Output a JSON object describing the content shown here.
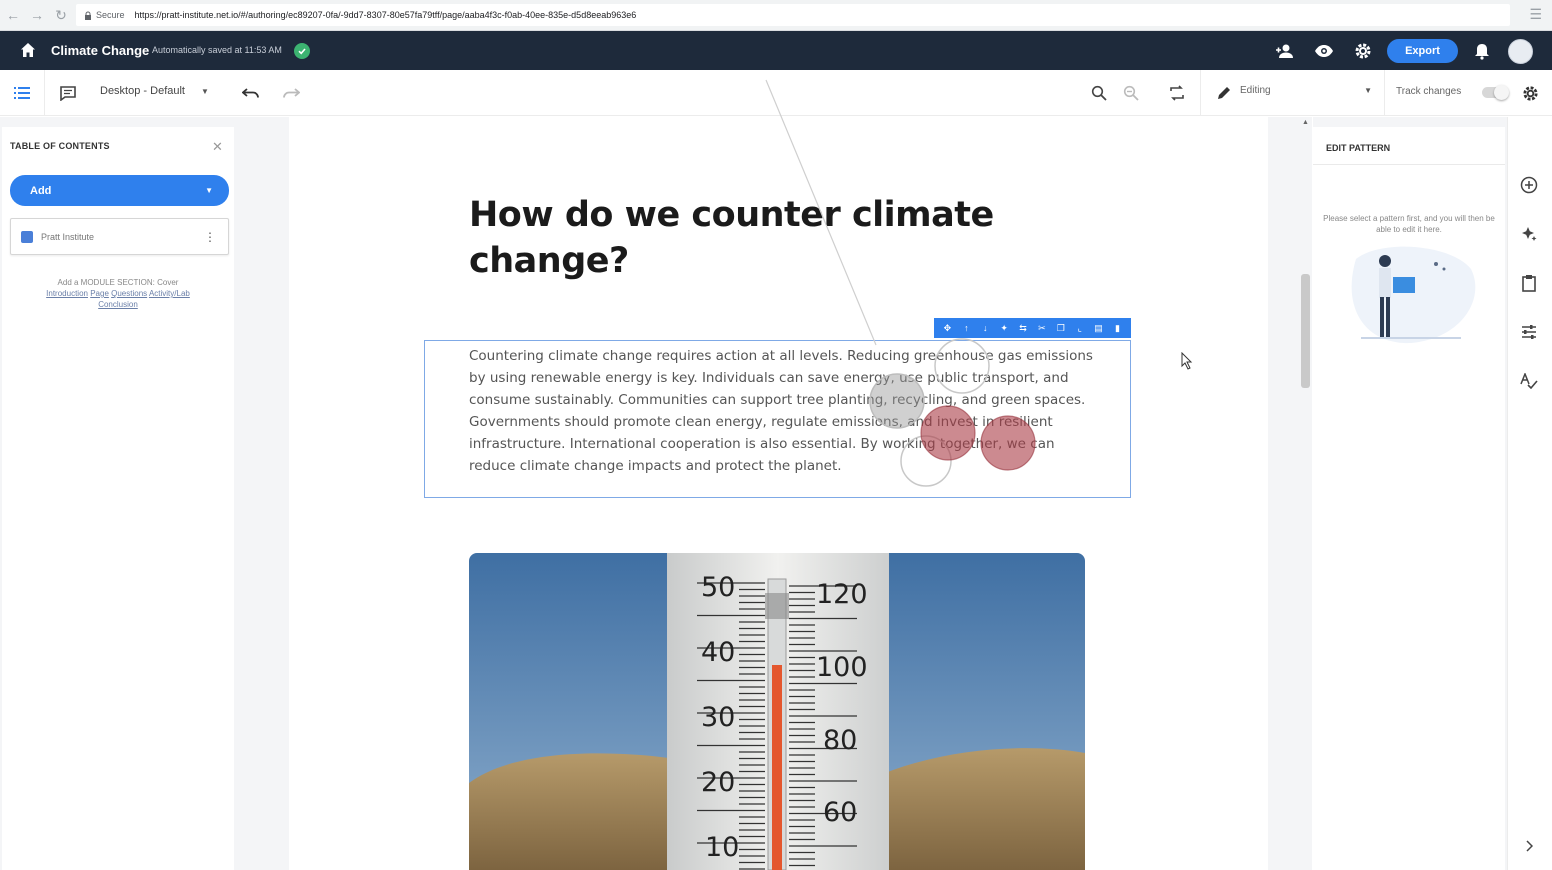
{
  "browser": {
    "secure_label": "Secure",
    "url": "https://pratt-institute.net.io/#/authoring/ec89207-0fa/-9dd7-8307-80e57fa79tff/page/aaba4f3c-f0ab-40ee-835e-d5d8eeab963e6"
  },
  "header": {
    "title": "Climate Change",
    "save_status": "Automatically saved at 11:53 AM",
    "export_label": "Export"
  },
  "toolbar": {
    "device_label": "Desktop - Default",
    "mode_label": "Editing",
    "track_changes_label": "Track changes",
    "track_changes_on": false
  },
  "toc": {
    "title": "TABLE OF CONTENTS",
    "add_label": "Add",
    "items": [
      {
        "label": "Pratt Institute"
      }
    ],
    "hint_prefix": "Add a MODULE SECTION: Cover",
    "hint_links": [
      "Introduction",
      "Page",
      "Questions",
      "Activity/Lab",
      "Conclusion"
    ]
  },
  "content": {
    "heading": "How do we counter climate change?",
    "paragraph": "Countering climate change requires action at all levels. Reducing greenhouse gas emissions by using renewable energy is key. Individuals can save energy, use public transport, and consume sustainably. Communities can support tree planting, recycling, and green spaces. Governments should promote clean energy, regulate emissions, and invest in resilient infrastructure. International cooperation is also essential. By working together, we can reduce climate change impacts and protect the planet.",
    "thermometer": {
      "left_scale": [
        "50",
        "40",
        "30",
        "20",
        "10"
      ],
      "right_scale": [
        "120",
        "100",
        "80",
        "60"
      ]
    }
  },
  "edit_pattern": {
    "title": "EDIT PATTERN",
    "hint": "Please select a pattern first, and you will then be able to edit it here."
  },
  "colors": {
    "header_bg": "#1e2a3b",
    "accent": "#2f80ed",
    "success": "#3cb371"
  }
}
